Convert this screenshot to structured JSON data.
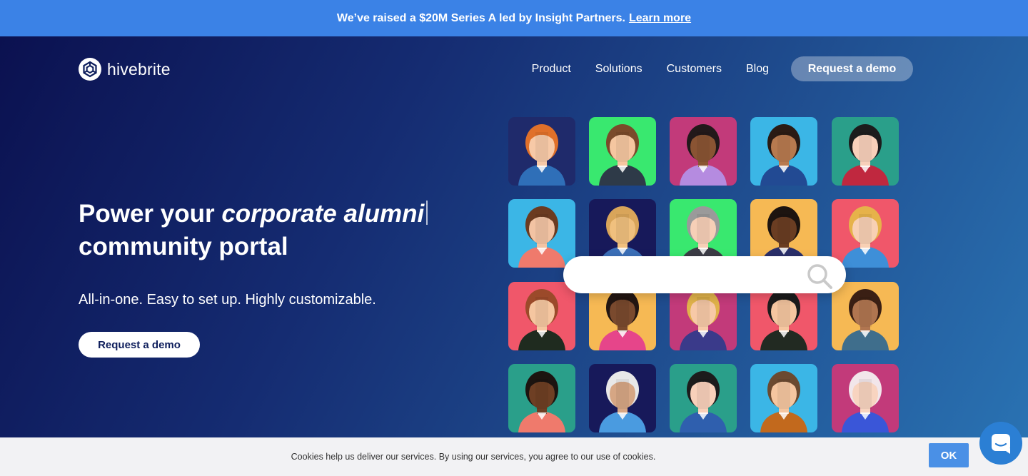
{
  "announcement": {
    "text": "We’ve raised a $20M Series A led by Insight Partners.",
    "link": "Learn more"
  },
  "brand": {
    "name": "hivebrite"
  },
  "nav": {
    "items": [
      "Product",
      "Solutions",
      "Customers",
      "Blog"
    ],
    "cta": "Request a demo"
  },
  "hero": {
    "headline_pre": "Power your ",
    "headline_em": "corporate alumni",
    "headline_line2": "community portal",
    "subhead": "All-in-one. Easy to set up. Highly customizable.",
    "cta": "Request a demo"
  },
  "search": {
    "icon": "search-icon"
  },
  "avatars": [
    {
      "bg": "#1f2a6b",
      "skin": "#f7c9a7",
      "hair": "#e0702a",
      "shirt": "#2f6fb8"
    },
    {
      "bg": "#39e86f",
      "skin": "#f5c6a0",
      "hair": "#7a4a2a",
      "shirt": "#2e3a48"
    },
    {
      "bg": "#c23a7a",
      "skin": "#8a5433",
      "hair": "#22191a",
      "shirt": "#b58be0"
    },
    {
      "bg": "#3bb6e6",
      "skin": "#b77a4f",
      "hair": "#2a1b14",
      "shirt": "#224a93"
    },
    {
      "bg": "#2a9f8a",
      "skin": "#f8d0ba",
      "hair": "#1c1c1c",
      "shirt": "#c0283f"
    },
    {
      "bg": "#3bb6e6",
      "skin": "#f2c3a3",
      "hair": "#6b3b20",
      "shirt": "#ef7a6c"
    },
    {
      "bg": "#17195a",
      "skin": "#f0c07e",
      "hair": "#d9a55a",
      "shirt": "#3b6fb8"
    },
    {
      "bg": "#39e86f",
      "skin": "#f6cfb7",
      "hair": "#9a9a9a",
      "shirt": "#3c3c46"
    },
    {
      "bg": "#f6b954",
      "skin": "#6a3d22",
      "hair": "#1d1410",
      "shirt": "#2a2f6a"
    },
    {
      "bg": "#f0576a",
      "skin": "#f8d0b4",
      "hair": "#e6b24a",
      "shirt": "#3e8fd8"
    },
    {
      "bg": "#f0576a",
      "skin": "#f5c6a0",
      "hair": "#9b4a2a",
      "shirt": "#1f2b1f"
    },
    {
      "bg": "#f6b954",
      "skin": "#7a4a2e",
      "hair": "#231612",
      "shirt": "#e6458a"
    },
    {
      "bg": "#c23a7a",
      "skin": "#f7c9a7",
      "hair": "#e0b24a",
      "shirt": "#3a3a8a"
    },
    {
      "bg": "#f0576a",
      "skin": "#f5c6a0",
      "hair": "#1c1c1c",
      "shirt": "#222a22"
    },
    {
      "bg": "#f6b954",
      "skin": "#b07550",
      "hair": "#3a1f14",
      "shirt": "#3f6e8c"
    },
    {
      "bg": "#2a9f8a",
      "skin": "#6e3f24",
      "hair": "#1c1410",
      "shirt": "#ef7a6c"
    },
    {
      "bg": "#17195a",
      "skin": "#d6a684",
      "hair": "#e8e8e8",
      "shirt": "#4a9be0"
    },
    {
      "bg": "#2a9f8a",
      "skin": "#f8d0ba",
      "hair": "#1c1c1c",
      "shirt": "#2f5fae"
    },
    {
      "bg": "#3bb6e6",
      "skin": "#f5c6a0",
      "hair": "#6b4a30",
      "shirt": "#c2691d"
    },
    {
      "bg": "#c23a7a",
      "skin": "#f8d4c0",
      "hair": "#f2e6ea",
      "shirt": "#3a56d8"
    }
  ],
  "cookie": {
    "text": "Cookies help us deliver our services. By using our services, you agree to our use of cookies.",
    "ok": "OK"
  },
  "chat": {
    "icon": "chat-icon"
  }
}
